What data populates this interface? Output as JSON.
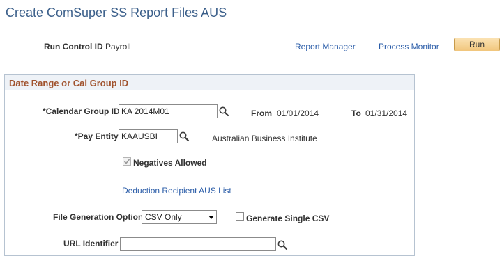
{
  "header": {
    "title": "Create ComSuper SS Report Files AUS",
    "run_control_label": "Run Control ID",
    "run_control_value": "Payroll",
    "report_manager_link": "Report Manager",
    "process_monitor_link": "Process Monitor",
    "run_button": "Run"
  },
  "group": {
    "title": "Date Range or Cal Group ID",
    "calendar_group_label": "*Calendar Group ID",
    "calendar_group_value": "KA 2014M01",
    "from_label": "From",
    "from_value": "01/01/2014",
    "to_label": "To",
    "to_value": "01/31/2014",
    "pay_entity_label": "*Pay Entity",
    "pay_entity_value": "KAAUSBI",
    "pay_entity_description": "Australian Business Institute",
    "negatives_allowed_label": "Negatives Allowed",
    "negatives_allowed_checked": true,
    "deduction_link": "Deduction Recipient AUS List",
    "file_generation_label": "File Generation Option",
    "file_generation_selected": "CSV Only",
    "generate_single_csv_label": "Generate Single CSV",
    "generate_single_csv_checked": false,
    "url_identifier_label": "URL Identifier",
    "url_identifier_value": ""
  },
  "icons": {
    "lookup": "magnifier-icon",
    "dropdown": "chevron-down-icon",
    "checkmark": "check-icon"
  },
  "colors": {
    "title": "#3b5f8a",
    "link": "#2a5ca8",
    "group_title": "#a0522d",
    "button_fill": "#f1c67c"
  }
}
